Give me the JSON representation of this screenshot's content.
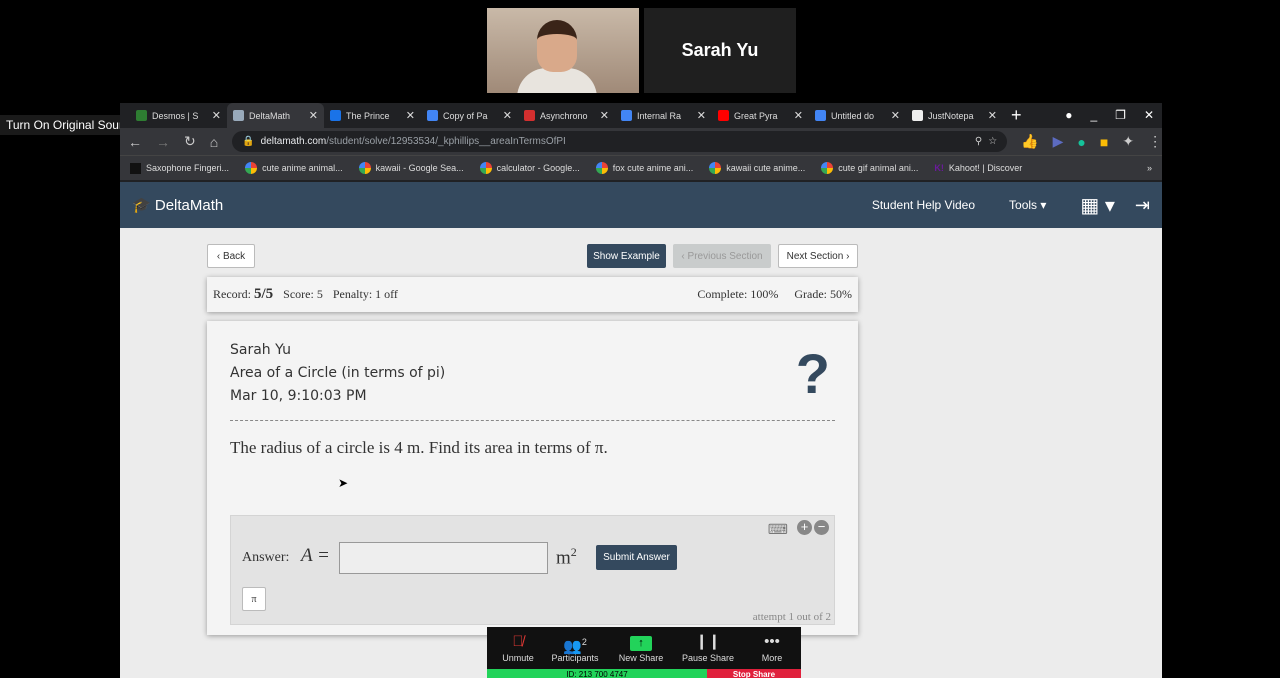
{
  "zoom": {
    "participant_name": "Sarah Yu",
    "original_sound": "Turn On Original Sound",
    "toolbar": [
      {
        "label": "Unmute",
        "icon": "mic-muted-icon"
      },
      {
        "label": "Participants",
        "icon": "participants-icon",
        "count": "2"
      },
      {
        "label": "New Share",
        "icon": "share-up-icon"
      },
      {
        "label": "Pause Share",
        "icon": "pause-icon"
      },
      {
        "label": "More",
        "icon": "more-icon"
      }
    ],
    "meeting_id": "ID: 213 700 4747",
    "stop_share": "Stop Share"
  },
  "browser": {
    "tabs": [
      {
        "label": "Desmos | S",
        "color": "#2e7d32"
      },
      {
        "label": "DeltaMath",
        "color": "#9ab",
        "active": true
      },
      {
        "label": "The Prince",
        "color": "#1a73e8"
      },
      {
        "label": "Copy of Pa",
        "color": "#4285f4"
      },
      {
        "label": "Asynchrono",
        "color": "#d32f2f"
      },
      {
        "label": "Internal Ra",
        "color": "#4285f4"
      },
      {
        "label": "Great Pyra",
        "color": "#ff0000"
      },
      {
        "label": "Untitled do",
        "color": "#4285f4"
      },
      {
        "label": "JustNotepa",
        "color": "#eee"
      }
    ],
    "url_domain": "deltamath.com",
    "url_path": "/student/solve/12953534/_kphillips__areaInTermsOfPI",
    "bookmarks": [
      "Saxophone Fingeri...",
      "cute anime animal...",
      "kawaii - Google Sea...",
      "calculator - Google...",
      "fox cute anime ani...",
      "kawaii cute anime...",
      "cute gif animal ani...",
      "Kahoot! | Discover"
    ]
  },
  "deltamath": {
    "logo": "DeltaMath",
    "nav": {
      "help": "Student Help Video",
      "tools": "Tools"
    },
    "buttons": {
      "back": "Back",
      "show_example": "Show Example",
      "previous": "Previous Section",
      "next": "Next Section"
    },
    "stats": {
      "record_label": "Record:",
      "record": "5/5",
      "score": "Score: 5",
      "penalty": "Penalty: 1 off",
      "complete": "Complete: 100%",
      "grade": "Grade: 50%"
    },
    "problem": {
      "student": "Sarah Yu",
      "title": "Area of a Circle (in terms of pi)",
      "date": "Mar 10, 9:10:03 PM",
      "question": "The radius of a circle is 4 m. Find its area in terms of π."
    },
    "answer": {
      "label": "Answer:",
      "var": "A =",
      "value": "",
      "unit": "m",
      "unit_exp": "2",
      "submit": "Submit Answer",
      "pi_button": "π",
      "attempt": "attempt 1 out of 2"
    }
  }
}
